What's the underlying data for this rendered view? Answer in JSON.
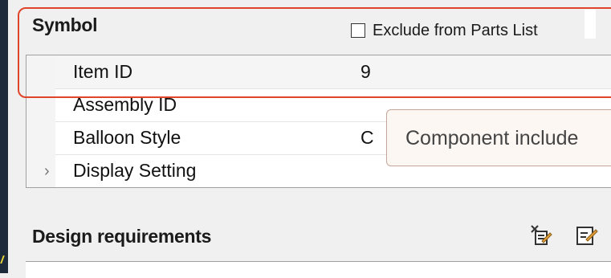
{
  "symbol_section": {
    "title": "Symbol",
    "exclude_label": "Exclude from Parts List",
    "exclude_checked": false
  },
  "properties": [
    {
      "name": "Item ID",
      "value": "9"
    },
    {
      "name": "Assembly ID",
      "value": ""
    },
    {
      "name": "Balloon Style",
      "value": "C"
    },
    {
      "name": "Display Setting",
      "value": "",
      "expandable": true
    }
  ],
  "tooltip": {
    "text": "Component include"
  },
  "design_section": {
    "title": "Design requirements",
    "icons": [
      "reset-requirements-icon",
      "edit-requirements-icon"
    ]
  },
  "colors": {
    "highlight": "#e0452b",
    "tooltip_bg": "#fdf7f3"
  }
}
